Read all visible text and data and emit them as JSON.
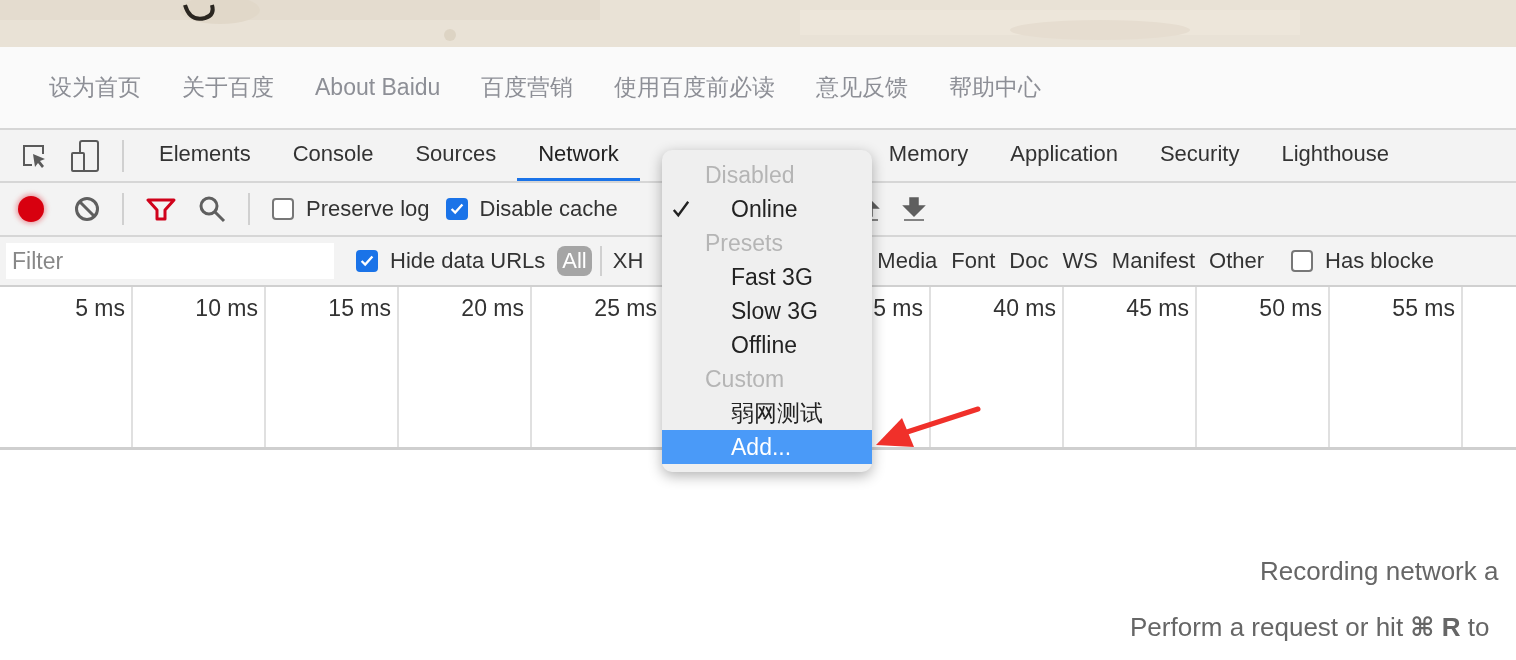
{
  "page_links": [
    "设为首页",
    "关于百度",
    "About Baidu",
    "百度营销",
    "使用百度前必读",
    "意见反馈",
    "帮助中心"
  ],
  "tabs": [
    {
      "label": "Elements",
      "selected": false
    },
    {
      "label": "Console",
      "selected": false
    },
    {
      "label": "Sources",
      "selected": false
    },
    {
      "label": "Network",
      "selected": true
    },
    {
      "label": "Memory",
      "selected": false
    },
    {
      "label": "Application",
      "selected": false
    },
    {
      "label": "Security",
      "selected": false
    },
    {
      "label": "Lighthouse",
      "selected": false
    }
  ],
  "toolbar": {
    "recording": true,
    "checkboxes": [
      {
        "label": "Preserve log",
        "checked": false
      },
      {
        "label": "Disable cache",
        "checked": true
      }
    ]
  },
  "filter_bar": {
    "placeholder": "Filter",
    "hide_data_urls": {
      "label": "Hide data URLs",
      "checked": true
    },
    "types": [
      {
        "label": "All",
        "selected": true
      },
      {
        "label": "XH",
        "selected": false
      },
      {
        "label": "Media",
        "selected": false
      },
      {
        "label": "Font",
        "selected": false
      },
      {
        "label": "Doc",
        "selected": false
      },
      {
        "label": "WS",
        "selected": false
      },
      {
        "label": "Manifest",
        "selected": false
      },
      {
        "label": "Other",
        "selected": false
      }
    ],
    "has_blocked": {
      "label": "Has blocke",
      "checked": false
    }
  },
  "timeline_ticks": [
    {
      "label": "5 ms"
    },
    {
      "label": "10 ms"
    },
    {
      "label": "15 ms"
    },
    {
      "label": "20 ms"
    },
    {
      "label": "25 ms"
    },
    {
      "label": "5 ms"
    },
    {
      "label": "40 ms"
    },
    {
      "label": "45 ms"
    },
    {
      "label": "50 ms"
    },
    {
      "label": "55 ms"
    }
  ],
  "empty_state": [
    "Recording network a",
    "Perform a request or hit **⌘ R** to"
  ],
  "throttle_menu": [
    {
      "kind": "header",
      "label": "Disabled"
    },
    {
      "kind": "item",
      "label": "Online",
      "checked": true,
      "selected": false
    },
    {
      "kind": "header",
      "label": "Presets"
    },
    {
      "kind": "item",
      "label": "Fast 3G",
      "checked": false,
      "selected": false
    },
    {
      "kind": "item",
      "label": "Slow 3G",
      "checked": false,
      "selected": false
    },
    {
      "kind": "item",
      "label": "Offline",
      "checked": false,
      "selected": false
    },
    {
      "kind": "header",
      "label": "Custom"
    },
    {
      "kind": "item",
      "label": "弱网测试",
      "checked": false,
      "selected": false
    },
    {
      "kind": "item",
      "label": "Add...",
      "checked": false,
      "selected": true
    }
  ]
}
